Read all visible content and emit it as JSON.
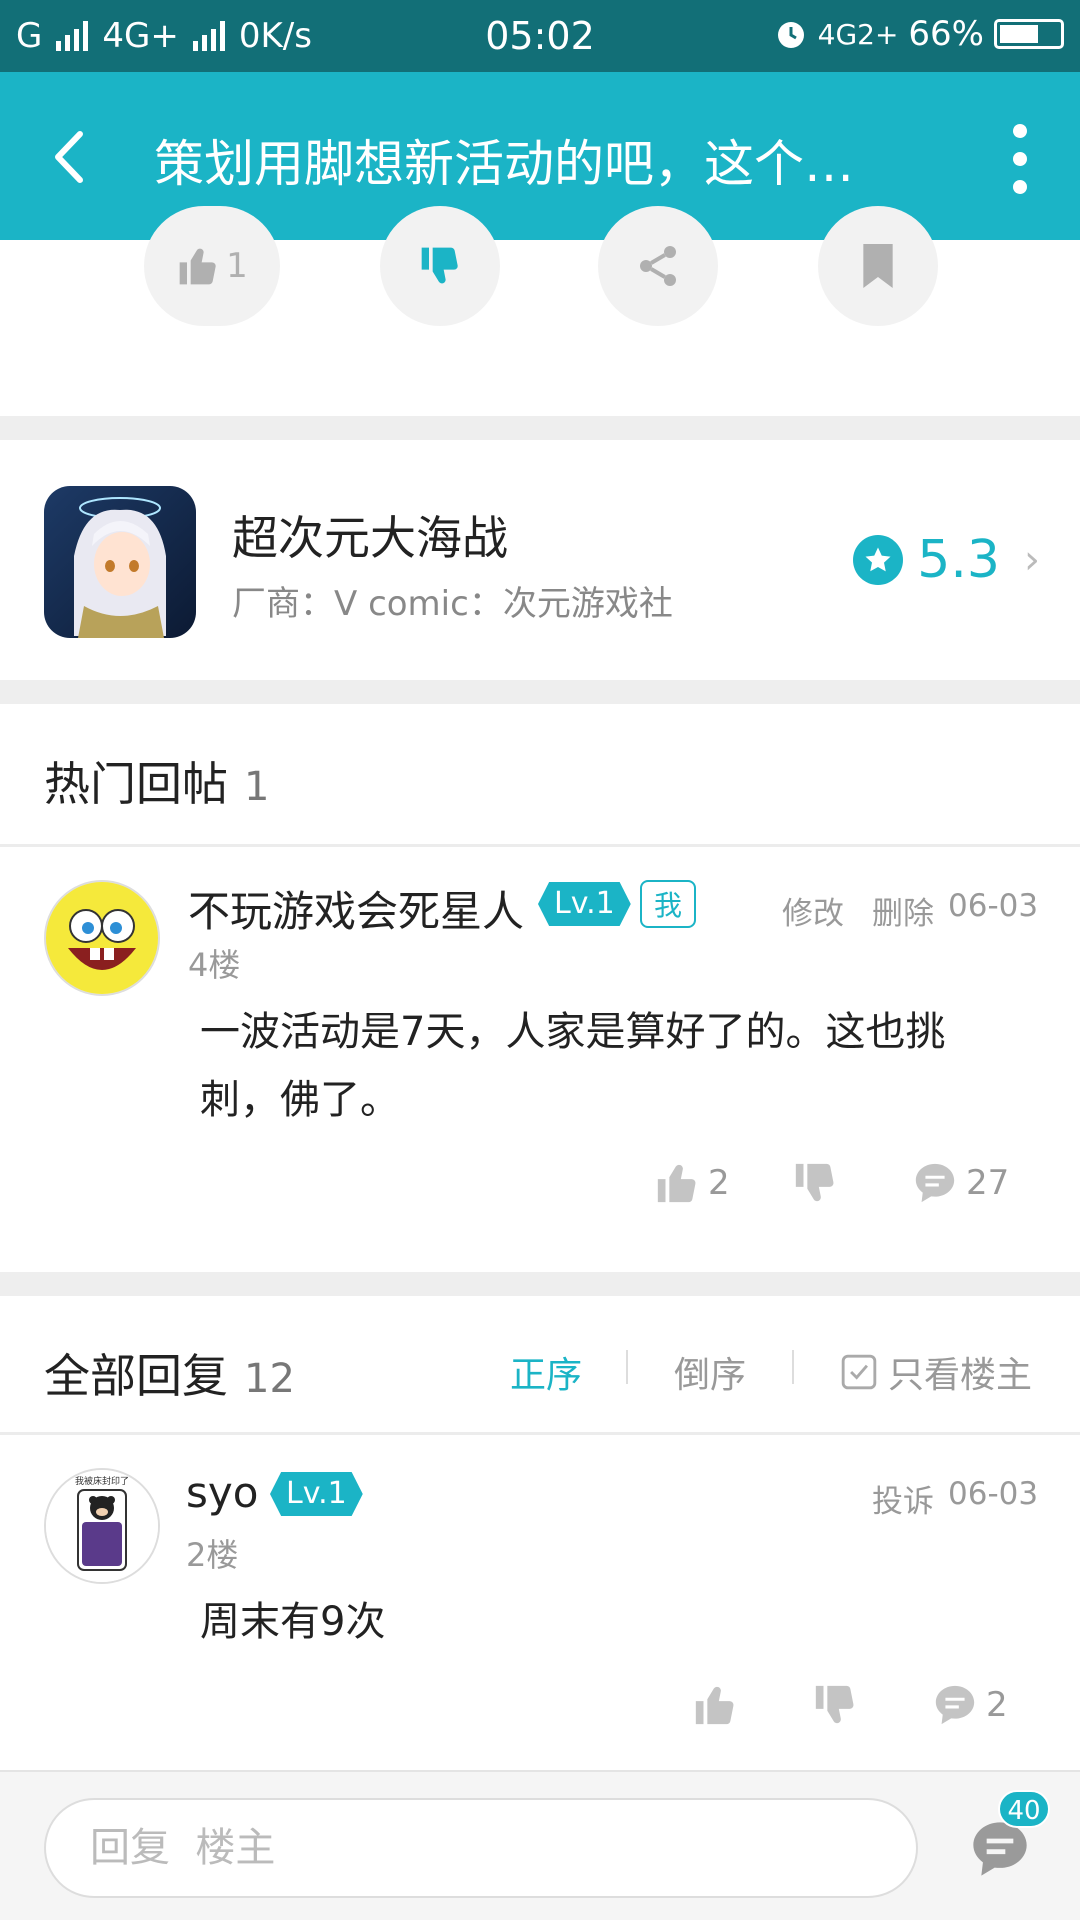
{
  "status_bar": {
    "carrier": "G",
    "network": "4G+",
    "speed": "0K/s",
    "time": "05:02",
    "network2": "4G2+",
    "battery": "66%",
    "battery_level": 0.66
  },
  "header": {
    "title": "策划用脚想新活动的吧，这个…"
  },
  "post_actions": {
    "like_count": "1"
  },
  "game": {
    "name": "超次元大海战",
    "vendor": "厂商：V comic：次元游戏社",
    "rating": "5.3"
  },
  "hot_replies": {
    "title": "热门回帖",
    "count": "1",
    "items": [
      {
        "username": "不玩游戏会死星人",
        "level": "Lv.1",
        "me_tag": "我",
        "edit": "修改",
        "delete": "删除",
        "date": "06-03",
        "floor": "4楼",
        "content": "一波活动是7天，人家是算好了的。这也挑刺，佛了。",
        "likes": "2",
        "comments": "27"
      }
    ]
  },
  "all_replies": {
    "title": "全部回复",
    "count": "12",
    "sort_asc": "正序",
    "sort_desc": "倒序",
    "only_op": "只看楼主",
    "items": [
      {
        "username": "syo",
        "level": "Lv.1",
        "report": "投诉",
        "date": "06-03",
        "floor": "2楼",
        "avatar_text": "我被床封印了",
        "content": "周末有9次",
        "comments": "2"
      }
    ]
  },
  "bottom_bar": {
    "placeholder": "回复  楼主",
    "badge": "40"
  },
  "colors": {
    "accent": "#1bb4c6",
    "status_bar": "#126f77"
  }
}
